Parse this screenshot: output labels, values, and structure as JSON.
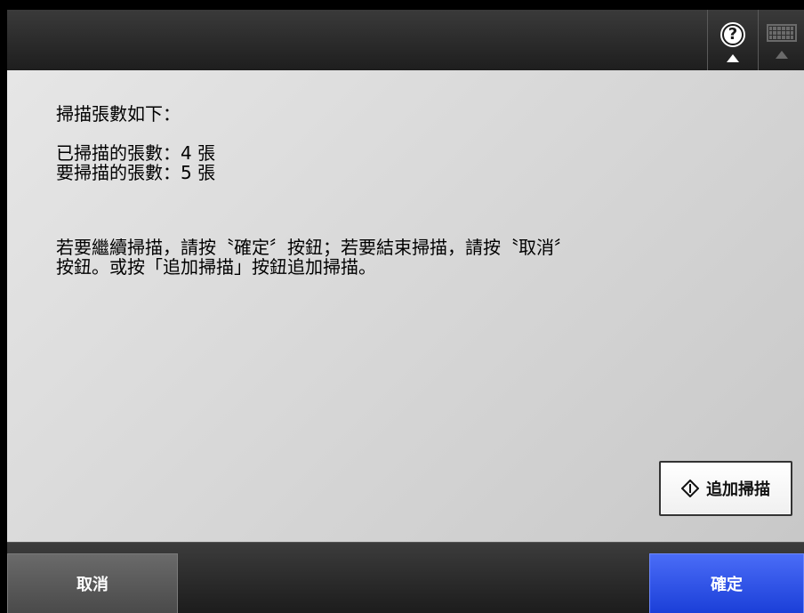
{
  "header": {
    "help_symbol": "?",
    "help_icon": "help-icon",
    "keyboard_icon": "keyboard-icon"
  },
  "message": {
    "intro": "掃描張數如下：",
    "scanned_label": "已掃描的張數：",
    "scanned_count": "4",
    "scanned_unit": "張",
    "to_scan_label": "要掃描的張數：",
    "to_scan_count": "5",
    "to_scan_unit": "張",
    "instruction_line1": "若要繼續掃描，請按〝確定〞按鈕；若要結束掃描，請按〝取消〞",
    "instruction_line2": "按鈕。或按「追加掃描」按鈕追加掃描。"
  },
  "buttons": {
    "add_scan": "追加掃描",
    "add_scan_icon": "diamond-start-icon",
    "cancel": "取消",
    "ok": "確定"
  },
  "colors": {
    "ok_button": "#2a4ee6",
    "cancel_button": "#5a5a5a",
    "content_bg": "#dcdcdc"
  }
}
